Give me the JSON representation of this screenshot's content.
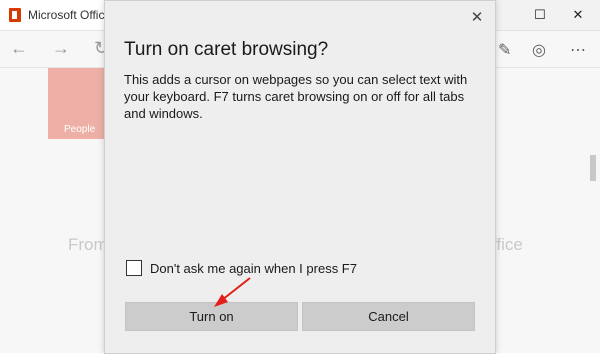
{
  "browser": {
    "tab_title": "Microsoft Office",
    "icons": [
      "back-icon",
      "forward-icon",
      "refresh-icon",
      "pen-icon",
      "share-icon",
      "more-icon"
    ],
    "window_controls": {
      "minimize": "—",
      "maximize": "☐",
      "close": "✕"
    }
  },
  "page": {
    "tile_label": "People",
    "background_text_left": "From",
    "background_text_right": "ffice"
  },
  "dialog": {
    "title": "Turn on caret browsing?",
    "body": "This adds a cursor on webpages so you can select text with your keyboard. F7 turns caret browsing on or off for all tabs and windows.",
    "checkbox_label": "Don't ask me again when I press F7",
    "checkbox_checked": false,
    "primary_button": "Turn on",
    "secondary_button": "Cancel",
    "close_glyph": "✕"
  },
  "colors": {
    "annotation_arrow": "#e32018",
    "tile_people": "#eeb0a6",
    "office_brand": "#d83b01"
  }
}
